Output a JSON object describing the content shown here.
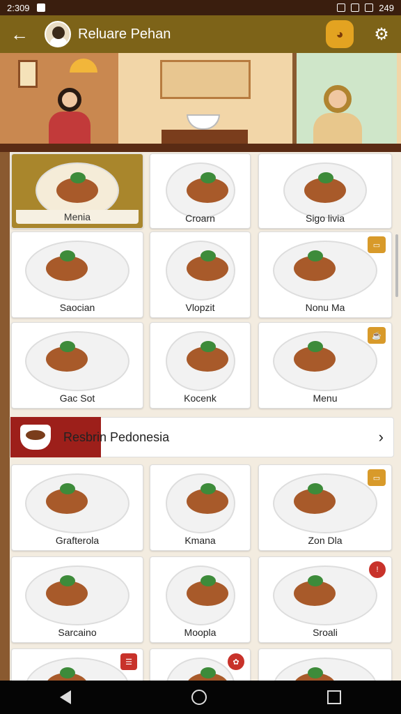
{
  "status_bar": {
    "time": "2:309",
    "clock_right": "249"
  },
  "header": {
    "title": "Reluare Pehan",
    "back_icon": "arrow-back-icon",
    "settings_icon": "settings-icon",
    "cart_icon": "basket-icon"
  },
  "rows": [
    [
      {
        "label": "Menia",
        "active": true
      },
      {
        "label": "Croarn"
      },
      {
        "label": "Sigo livia"
      }
    ],
    [
      {
        "label": "Saocian"
      },
      {
        "label": "Vlopzit"
      },
      {
        "label": "Nonu Ma",
        "badge": "▭"
      }
    ],
    [
      {
        "label": "Gac Sot"
      },
      {
        "label": "Kocenk"
      },
      {
        "label": "Menu",
        "badge": "☕"
      }
    ]
  ],
  "resto_bar": {
    "text": "Resbrin Pedonesia"
  },
  "rows2": [
    [
      {
        "label": "Grafterola"
      },
      {
        "label": "Kmana"
      },
      {
        "label": "Zon Dla",
        "badge": "▭"
      }
    ],
    [
      {
        "label": "Sarcaino"
      },
      {
        "label": "Moopla"
      },
      {
        "label": "Sroali",
        "badge": "!"
      }
    ],
    [
      {
        "label": "",
        "badge": "☰"
      },
      {
        "label": "",
        "badge": "✿"
      },
      {
        "label": ""
      }
    ]
  ]
}
